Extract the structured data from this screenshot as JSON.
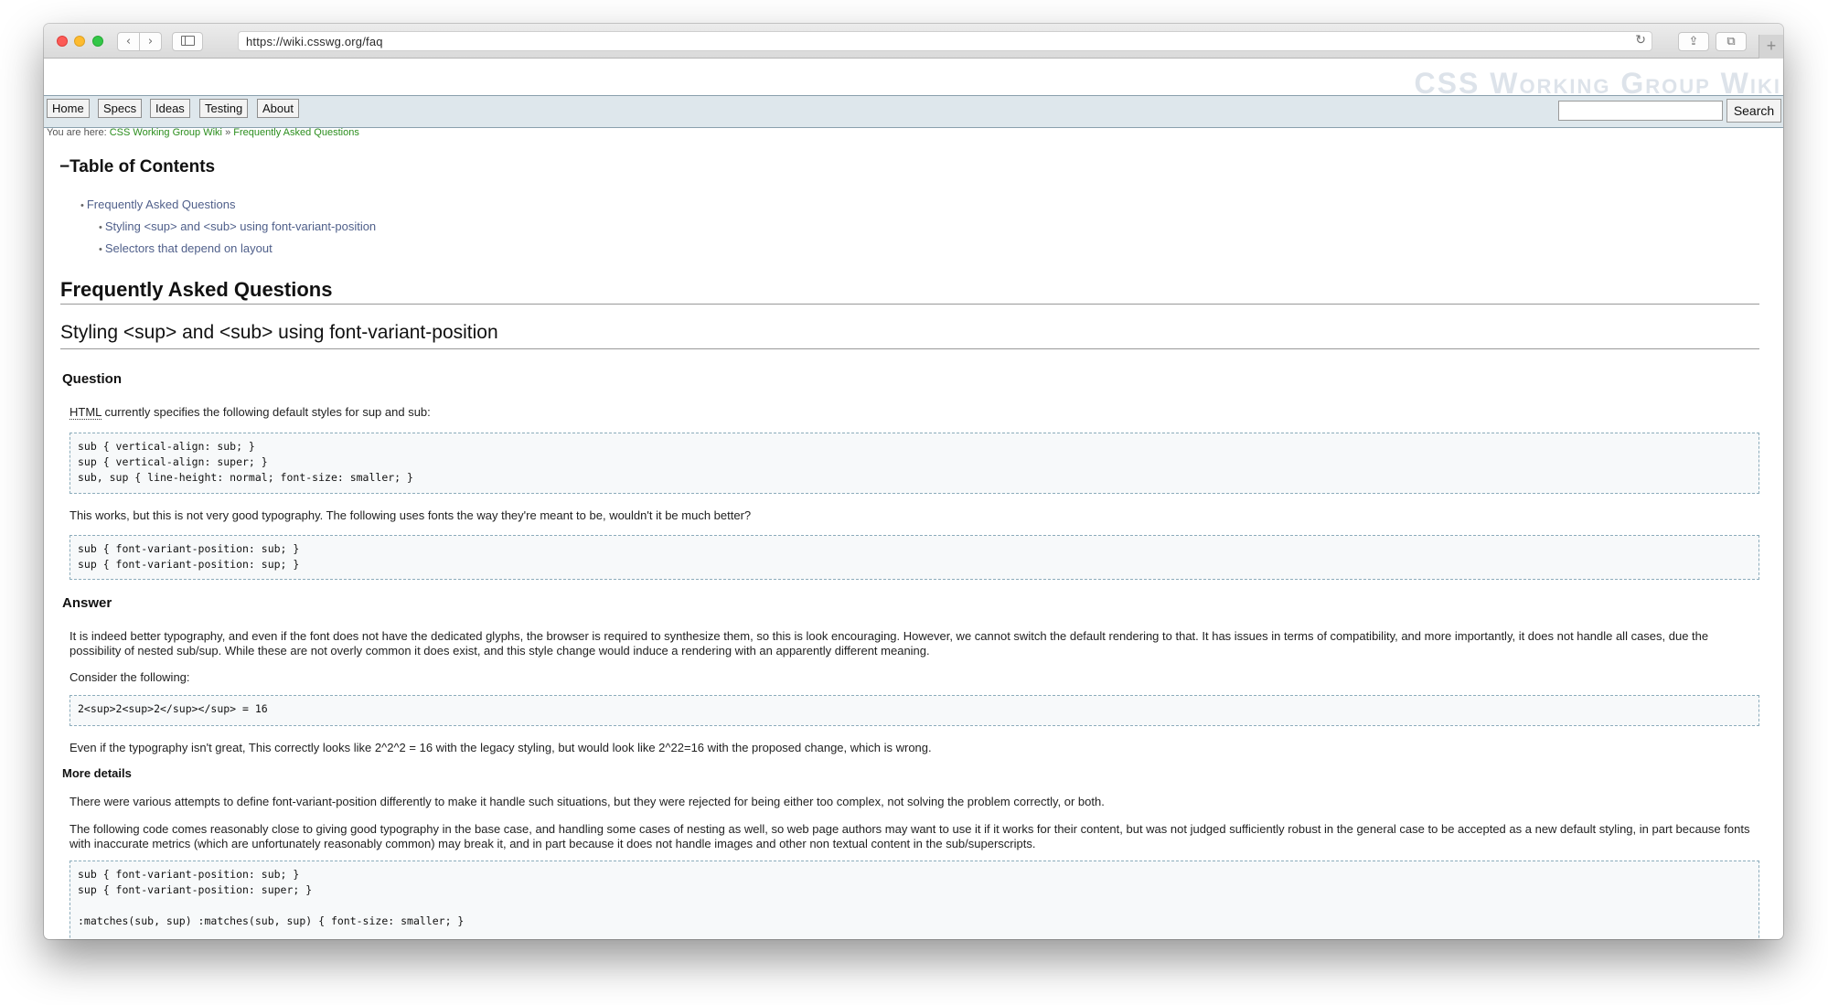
{
  "browser": {
    "url": "https://wiki.csswg.org/faq"
  },
  "site": {
    "title": "CSS Working Group Wiki",
    "nav": [
      "Home",
      "Specs",
      "Ideas",
      "Testing",
      "About"
    ],
    "search_button": "Search",
    "breadcrumb": {
      "prefix": "You are here:",
      "root": "CSS Working Group Wiki",
      "separator": "»",
      "current": "Frequently Asked Questions"
    }
  },
  "toc": {
    "title": "−Table of Contents",
    "items": [
      {
        "label": "Frequently Asked Questions",
        "level": 1
      },
      {
        "label": "Styling <sup> and <sub> using font-variant-position",
        "level": 2
      },
      {
        "label": "Selectors that depend on layout",
        "level": 2
      }
    ]
  },
  "article": {
    "h1": "Frequently Asked Questions",
    "h2": "Styling <sup> and <sub> using font-variant-position",
    "question_heading": "Question",
    "q_intro_abbr": "HTML",
    "q_intro_rest": " currently specifies the following default styles for sup and sub:",
    "code1": [
      "sub { vertical-align: sub; }",
      "sup { vertical-align: super; }",
      "sub, sup { line-height: normal; font-size: smaller; }"
    ],
    "q_followup": "This works, but this is not very good typography. The following uses fonts the way they're meant to be, wouldn't it be much better?",
    "code2": [
      "sub { font-variant-position: sub; }",
      "sup { font-variant-position: sup; }"
    ],
    "answer_heading": "Answer",
    "answer_p1": "It is indeed better typography, and even if the font does not have the dedicated glyphs, the browser is required to synthesize them, so this is look encouraging. However, we cannot switch the default rendering to that. It has issues in terms of compatibility, and more importantly, it does not handle all cases, due the possibility of nested sub/sup. While these are not overly common it does exist, and this style change would induce a rendering with an apparently different meaning.",
    "answer_p2": "Consider the following:",
    "code3": "2<sup>2<sup>2</sup></sup> = 16",
    "answer_p3": "Even if the typography isn't great, This correctly looks like 2^2^2 = 16 with the legacy styling, but would look like 2^22=16 with the proposed change, which is wrong.",
    "more_heading": "More details",
    "more_p1": "There were various attempts to define font-variant-position differently to make it handle such situations, but they were rejected for being either too complex, not solving the problem correctly, or both.",
    "more_p2": "The following code comes reasonably close to giving good typography in the base case, and handling some cases of nesting as well, so web page authors may want to use it if it works for their content, but was not judged sufficiently robust in the general case to be accepted as a new default styling, in part because fonts with inaccurate metrics (which are unfortunately reasonably common) may break it, and in part because it does not handle images and other non textual content in the sub/superscripts.",
    "code4": [
      "sub { font-variant-position: sub; }",
      "sup { font-variant-position: super; }",
      "",
      ":matches(sub, sup) :matches(sub, sup) { font-size: smaller; }"
    ]
  },
  "colors": {
    "link_green": "#2a8d1c",
    "toc_link": "#4f5f8a",
    "nav_bg": "#dee7ec",
    "code_border": "#8cacbb"
  }
}
